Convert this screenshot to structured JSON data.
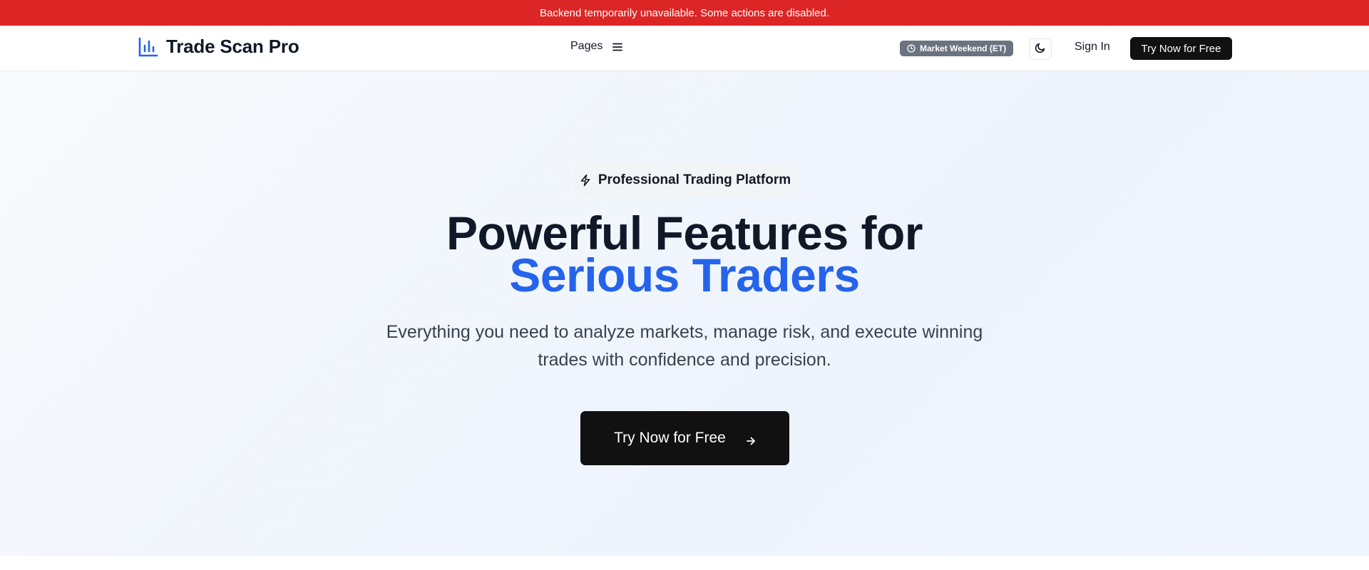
{
  "alert": {
    "message": "Backend temporarily unavailable. Some actions are disabled."
  },
  "navbar": {
    "brand_name": "Trade Scan Pro",
    "brand_icon": "bar-chart-icon",
    "pages_label": "Pages",
    "market_status": "Market Weekend (ET)",
    "sign_in_label": "Sign In",
    "try_label": "Try Now for Free"
  },
  "hero": {
    "badge_text": "Professional Trading Platform",
    "title_line1": "Powerful Features for",
    "title_line2": "Serious Traders",
    "subtitle": "Everything you need to analyze markets, manage risk, and execute winning trades with confidence and precision.",
    "cta_label": "Try Now for Free"
  },
  "colors": {
    "alert_bg": "#dc2626",
    "brand_accent": "#2563eb",
    "button_bg": "#111111",
    "badge_bg": "#6b7280"
  }
}
